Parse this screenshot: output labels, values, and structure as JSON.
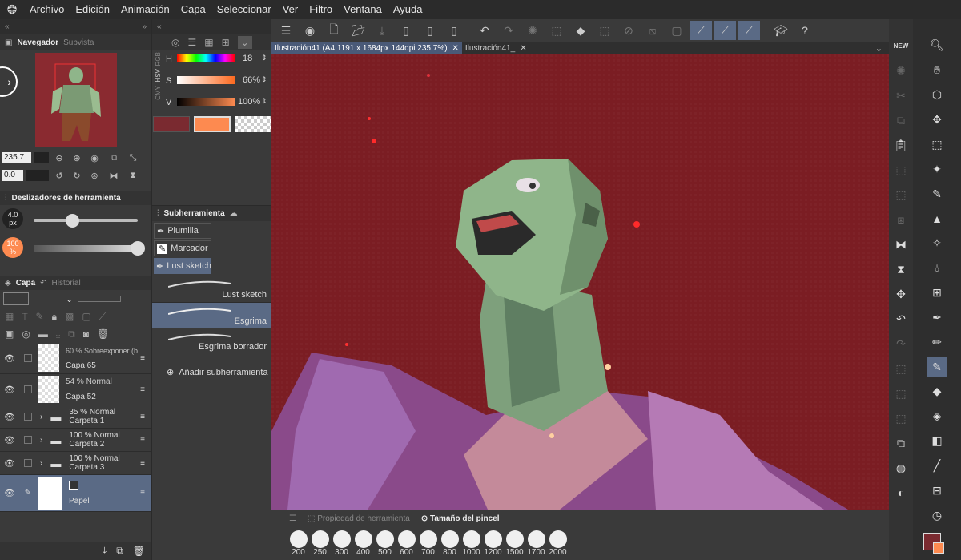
{
  "menu": [
    "Archivo",
    "Edición",
    "Animación",
    "Capa",
    "Seleccionar",
    "Ver",
    "Filtro",
    "Ventana",
    "Ayuda"
  ],
  "navigator": {
    "tab": "Navegador",
    "tab2": "Subvista",
    "zoom": "235.7",
    "angle": "0.0"
  },
  "color": {
    "modes": [
      "RGB",
      "HSV",
      "CMY"
    ],
    "h_label": "H",
    "h_value": "18",
    "s_label": "S",
    "s_value": "66%",
    "v_label": "V",
    "v_value": "100%",
    "main_color": "#7a2a30",
    "sub_color": "#fd8a50"
  },
  "tool_sliders": {
    "title": "Deslizadores de herramienta",
    "size": "4.0",
    "size_unit": "px",
    "opacity": "100",
    "opacity_unit": "%"
  },
  "subtool": {
    "title": "Subherramienta",
    "groups": [
      "Plumilla",
      "Marcador",
      "Lust sketch"
    ],
    "brushes": [
      "Lust sketch",
      "Esgrima",
      "Esgrima borrador"
    ],
    "add": "Añadir subherramienta"
  },
  "layers_panel": {
    "tab": "Capa",
    "tab2": "Historial",
    "layers": [
      {
        "mode": "60 % Sobreexponer (b",
        "name": "Capa 65"
      },
      {
        "mode": "54 % Normal",
        "name": "Capa 52"
      },
      {
        "mode": "35 % Normal",
        "name": "Carpeta 1"
      },
      {
        "mode": "100 % Normal",
        "name": "Carpeta 2"
      },
      {
        "mode": "100 % Normal",
        "name": "Carpeta 3"
      },
      {
        "mode": "",
        "name": "Papel"
      }
    ]
  },
  "tabs": [
    "Ilustración41 (A4 1191 x 1684px 144dpi 235.7%)",
    "Ilustración41_"
  ],
  "bottom": {
    "tab1": "Propiedad de herramienta",
    "tab2": "Tamaño del pincel",
    "sizes": [
      "200",
      "250",
      "300",
      "400",
      "500",
      "600",
      "700",
      "800",
      "1000",
      "1200",
      "1500",
      "1700",
      "2000"
    ]
  },
  "right": {
    "new_badge": "NEW"
  }
}
